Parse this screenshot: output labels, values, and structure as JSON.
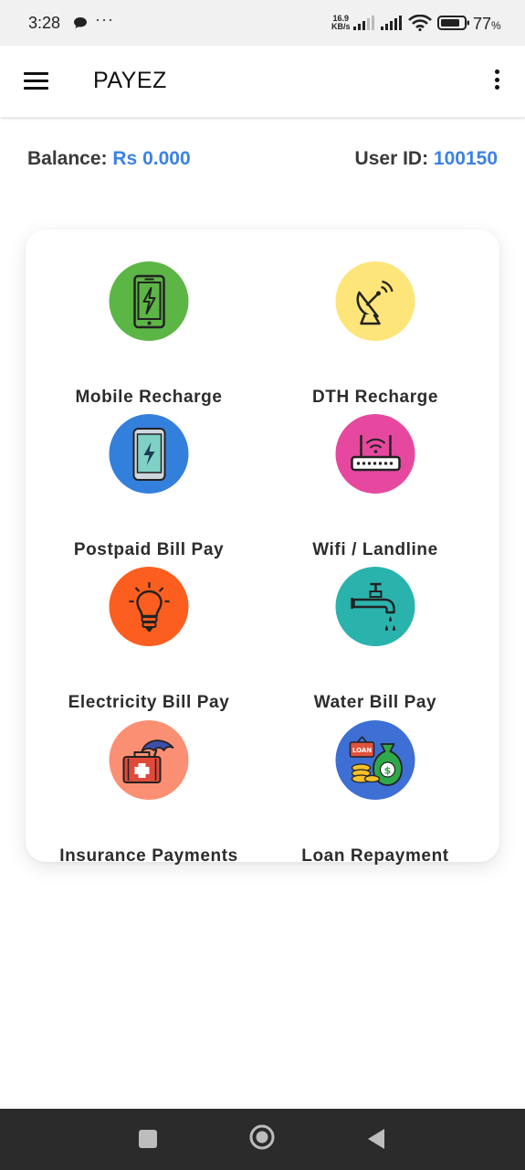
{
  "status_bar": {
    "time": "3:28",
    "speed_value": "16.9",
    "speed_unit": "KB/s",
    "battery": "77",
    "battery_unit": "%"
  },
  "app_bar": {
    "title": "PAYEZ"
  },
  "info": {
    "balance_label": "Balance:",
    "balance_value": "Rs 0.000",
    "user_label": "User ID:",
    "user_value": "100150"
  },
  "services": [
    {
      "label": "Mobile Recharge",
      "color": "#5cb646",
      "icon": "smartphone-lightning-icon"
    },
    {
      "label": "DTH Recharge",
      "color": "#fde57a",
      "icon": "satellite-dish-icon"
    },
    {
      "label": "Postpaid Bill Pay",
      "color": "#3380dc",
      "icon": "phone-charge-icon"
    },
    {
      "label": "Wifi / Landline",
      "color": "#e6489f",
      "icon": "wifi-router-icon"
    },
    {
      "label": "Electricity Bill Pay",
      "color": "#fb5e1e",
      "icon": "light-bulb-icon"
    },
    {
      "label": "Water Bill Pay",
      "color": "#2ab3ad",
      "icon": "water-tap-icon"
    },
    {
      "label": "Insurance Payments",
      "color": "#fb8f73",
      "icon": "medical-umbrella-icon"
    },
    {
      "label": "Loan Repayment",
      "color": "#3d6fd4",
      "icon": "money-bag-icon"
    }
  ]
}
